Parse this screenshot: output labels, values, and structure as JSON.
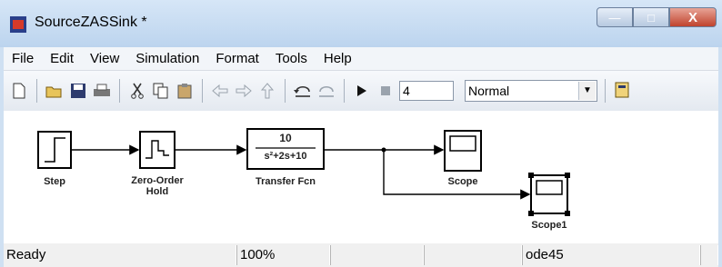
{
  "window": {
    "title": "SourceZASSink *",
    "min_glyph": "—",
    "max_glyph": "□",
    "close_glyph": "X"
  },
  "menu": [
    "File",
    "Edit",
    "View",
    "Simulation",
    "Format",
    "Tools",
    "Help"
  ],
  "toolbar": {
    "icons": [
      "new-file-icon",
      "open-icon",
      "save-icon",
      "print-icon",
      "cut-icon",
      "copy-icon",
      "paste-icon",
      "back-icon",
      "forward-icon",
      "up-icon",
      "undo-icon",
      "redo-icon",
      "start-simulation-icon",
      "stop-simulation-icon",
      "library-browser-icon"
    ],
    "stop_time": "4",
    "sim_mode": "Normal"
  },
  "diagram": {
    "blocks": {
      "step": "Step",
      "zoh_line1": "Zero-Order",
      "zoh_line2": "Hold",
      "tf_num": "10",
      "tf_den": "s²+2s+10",
      "tf": "Transfer Fcn",
      "scope": "Scope",
      "scope1": "Scope1"
    }
  },
  "status": {
    "ready": "Ready",
    "zoom": "100%",
    "solver": "ode45"
  }
}
